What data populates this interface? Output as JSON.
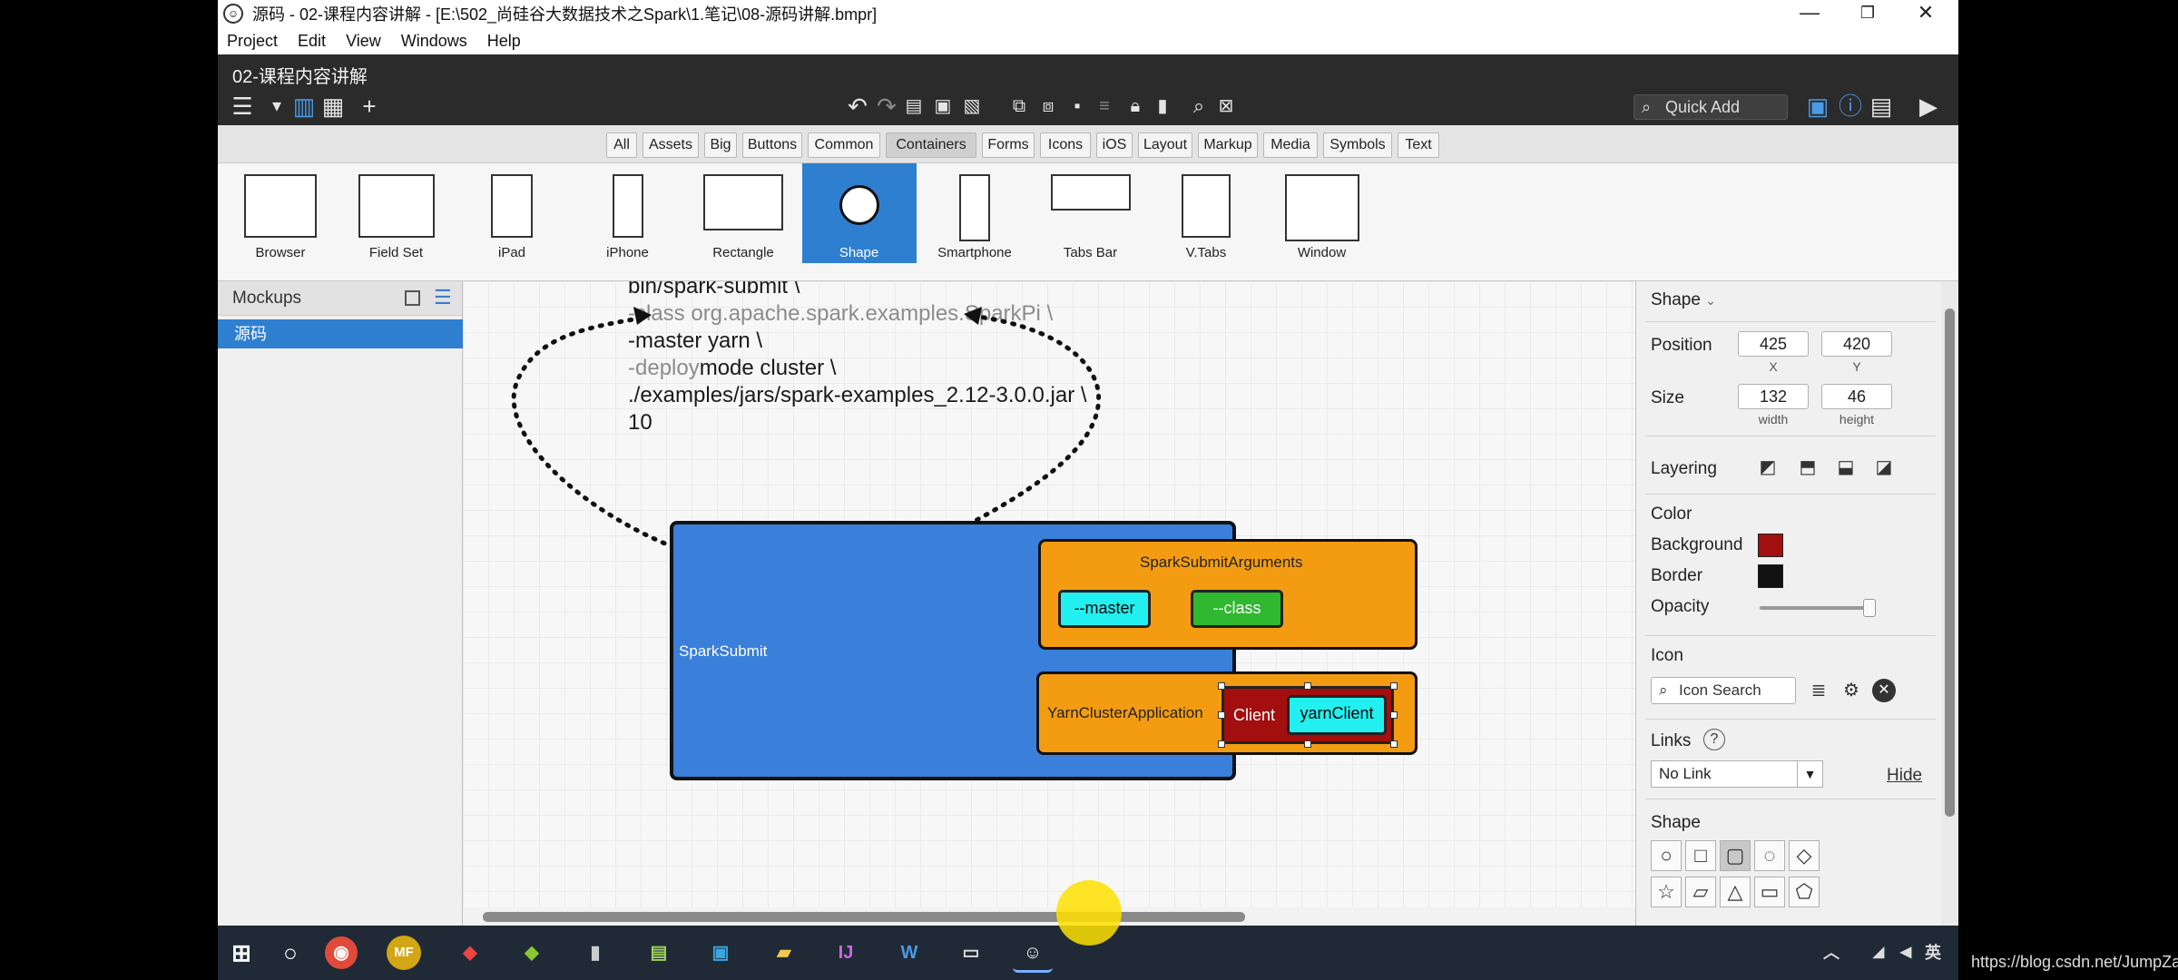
{
  "window": {
    "title": "源码 - 02-课程内容讲解 - [E:\\502_尚硅谷大数据技术之Spark\\1.笔记\\08-源码讲解.bmpr]",
    "app_icon": "smiley-icon"
  },
  "menu": [
    "Project",
    "Edit",
    "View",
    "Windows",
    "Help"
  ],
  "project_title": "02-课程内容讲解",
  "quick_add": {
    "placeholder": "Quick Add"
  },
  "filter_tabs": [
    "All",
    "Assets",
    "Big",
    "Buttons",
    "Common",
    "Containers",
    "Forms",
    "Icons",
    "iOS",
    "Layout",
    "Markup",
    "Media",
    "Symbols",
    "Text"
  ],
  "filter_active": "Containers",
  "library": [
    "Browser",
    "Field Set",
    "iPad",
    "iPhone",
    "Rectangle",
    "Shape",
    "Smartphone",
    "Tabs Bar",
    "V.Tabs",
    "Window"
  ],
  "library_selected": "Shape",
  "mockups": {
    "header": "Mockups",
    "items": [
      "源码"
    ]
  },
  "canvas": {
    "code": [
      {
        "gray": "",
        "black": "bin/spark-submit \\"
      },
      {
        "gray": "-class org.apache.spark.examples.SparkPi \\",
        "black": ""
      },
      {
        "gray": "",
        "black": "-master yarn \\"
      },
      {
        "gray": "-deploy",
        "black": "mode cluster \\"
      },
      {
        "gray": "",
        "black": "./examples/jars/spark-examples_2.12-3.0.0.jar \\"
      },
      {
        "gray": "",
        "black": "10"
      }
    ],
    "diagram": {
      "outer": "SparkSubmit",
      "args_box": "SparkSubmitArguments",
      "master": "--master",
      "class": "--class",
      "yarn_box": "YarnClusterApplication",
      "client": "Client",
      "yarn_client": "yarnClient"
    },
    "colors": {
      "outer": "#3a7fd9",
      "inner": "#f39c12",
      "cyan": "#22f0f0",
      "green": "#2fb830",
      "client": "#a30e0e"
    }
  },
  "properties": {
    "header": "Shape",
    "position_label": "Position",
    "x": "425",
    "y": "420",
    "x_label": "X",
    "y_label": "Y",
    "size_label": "Size",
    "width": "132",
    "height": "46",
    "width_label": "width",
    "height_label": "height",
    "layering_label": "Layering",
    "color_label": "Color",
    "background_label": "Background",
    "background_color": "#a30e0e",
    "border_label": "Border",
    "border_color": "#111111",
    "opacity_label": "Opacity",
    "opacity": 1.0,
    "icon_label": "Icon",
    "icon_search_placeholder": "Icon Search",
    "links_label": "Links",
    "links_value": "No Link",
    "hide_label": "Hide",
    "shape_label": "Shape"
  },
  "watermark": "https://blog.csdn.net/JumpZard",
  "tray": {
    "ime": "英"
  }
}
